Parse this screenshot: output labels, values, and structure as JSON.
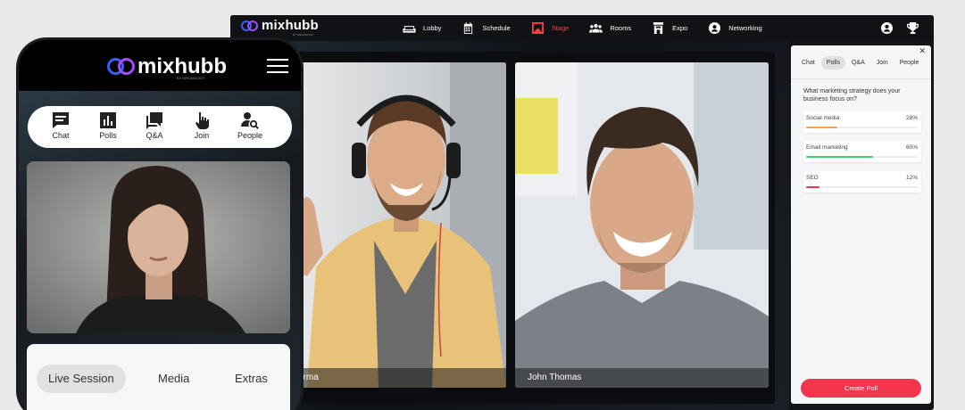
{
  "desktop": {
    "brand": "mixhubb",
    "tagline": "BY DREAMCAST",
    "nav": [
      {
        "label": "Lobby",
        "icon": "sofa-icon"
      },
      {
        "label": "Schedule",
        "icon": "calendar-icon"
      },
      {
        "label": "Stage",
        "icon": "stage-icon",
        "active": true
      },
      {
        "label": "Rooms",
        "icon": "people-group-icon"
      },
      {
        "label": "Expo",
        "icon": "booth-icon"
      },
      {
        "label": "Networking",
        "icon": "networking-icon"
      }
    ],
    "speakers": [
      {
        "name": "arma"
      },
      {
        "name": "John Thomas"
      }
    ],
    "panel": {
      "tabs": [
        "Chat",
        "Polls",
        "Q&A",
        "Join",
        "People"
      ],
      "active_tab": "Polls",
      "question": "What marketing strategy does your business focus on?",
      "options": [
        {
          "label": "Social media",
          "percent": "28%",
          "value": 0.28,
          "color": "#f4a24e"
        },
        {
          "label": "Email marketing",
          "percent": "60%",
          "value": 0.6,
          "color": "#3ecf6a"
        },
        {
          "label": "SEO",
          "percent": "12%",
          "value": 0.12,
          "color": "#e8334a"
        }
      ],
      "create_button": "Create Poll"
    }
  },
  "phone": {
    "brand": "mixhubb",
    "tagline": "BY DREAMCAST",
    "tabs": [
      {
        "label": "Chat",
        "icon": "chat-icon"
      },
      {
        "label": "Polls",
        "icon": "poll-icon"
      },
      {
        "label": "Q&A",
        "icon": "qa-icon"
      },
      {
        "label": "Join",
        "icon": "hand-pointer-icon"
      },
      {
        "label": "People",
        "icon": "people-search-icon"
      }
    ],
    "bottom_tabs": [
      "Live Session",
      "Media",
      "Extras"
    ],
    "active_bottom_tab": "Live Session"
  },
  "colors": {
    "accent_red": "#f2364d",
    "logo_blue": "#3a5cff",
    "logo_purple": "#a34cff"
  }
}
